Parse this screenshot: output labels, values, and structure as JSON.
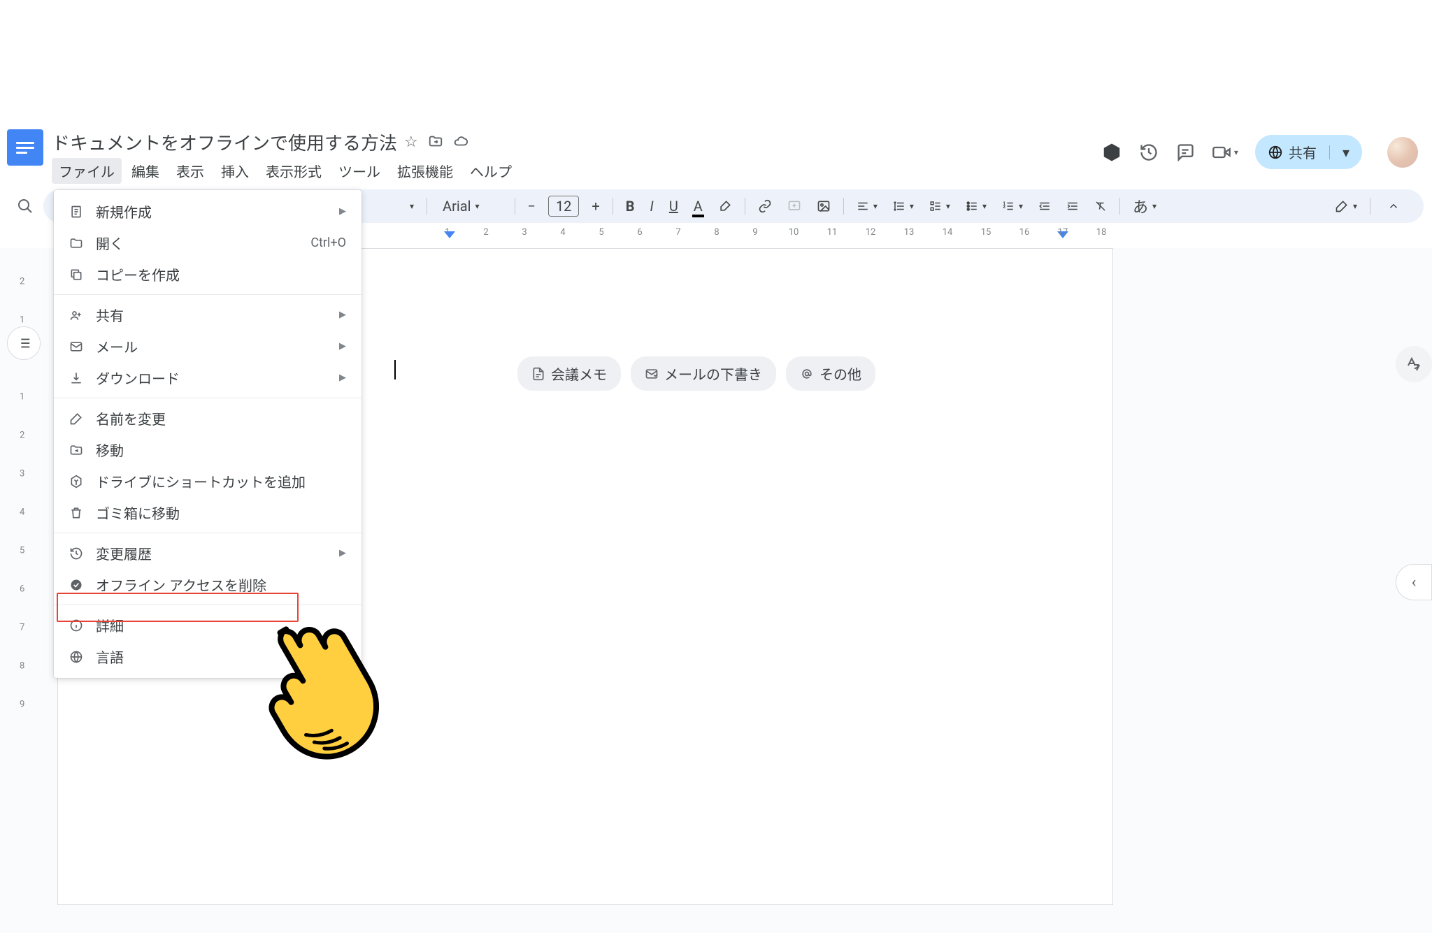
{
  "doc_title": "ドキュメントをオフラインで使用する方法",
  "menubar": [
    "ファイル",
    "編集",
    "表示",
    "挿入",
    "表示形式",
    "ツール",
    "拡張機能",
    "ヘルプ"
  ],
  "active_menu_index": 0,
  "share_label": "共有",
  "toolbar": {
    "font_name": "Arial",
    "font_size": "12",
    "ime_indicator": "あ"
  },
  "ruler_h": [
    "1",
    "2",
    "3",
    "4",
    "5",
    "6",
    "7",
    "8",
    "9",
    "10",
    "11",
    "12",
    "13",
    "14",
    "15",
    "16",
    "17",
    "18"
  ],
  "ruler_v": [
    "2",
    "1",
    "",
    "1",
    "2",
    "3",
    "4",
    "5",
    "6",
    "7",
    "8",
    "9"
  ],
  "chips": [
    {
      "icon": "page",
      "label": "会議メモ"
    },
    {
      "icon": "mail",
      "label": "メールの下書き"
    },
    {
      "icon": "at",
      "label": "その他"
    }
  ],
  "file_menu": [
    {
      "icon": "new",
      "label": "新規作成",
      "arrow": true
    },
    {
      "icon": "open",
      "label": "開く",
      "shortcut": "Ctrl+O"
    },
    {
      "icon": "copy",
      "label": "コピーを作成"
    },
    {
      "sep": true
    },
    {
      "icon": "share",
      "label": "共有",
      "arrow": true
    },
    {
      "icon": "mail",
      "label": "メール",
      "arrow": true
    },
    {
      "icon": "download",
      "label": "ダウンロード",
      "arrow": true
    },
    {
      "sep": true
    },
    {
      "icon": "rename",
      "label": "名前を変更"
    },
    {
      "icon": "move",
      "label": "移動"
    },
    {
      "icon": "shortcut",
      "label": "ドライブにショートカットを追加"
    },
    {
      "icon": "trash",
      "label": "ゴミ箱に移動"
    },
    {
      "sep": true
    },
    {
      "icon": "history",
      "label": "変更履歴",
      "arrow": true
    },
    {
      "icon": "offline",
      "label": "オフライン アクセスを削除"
    },
    {
      "sep": true
    },
    {
      "icon": "info",
      "label": "詳細"
    },
    {
      "icon": "lang",
      "label": "言語"
    }
  ]
}
